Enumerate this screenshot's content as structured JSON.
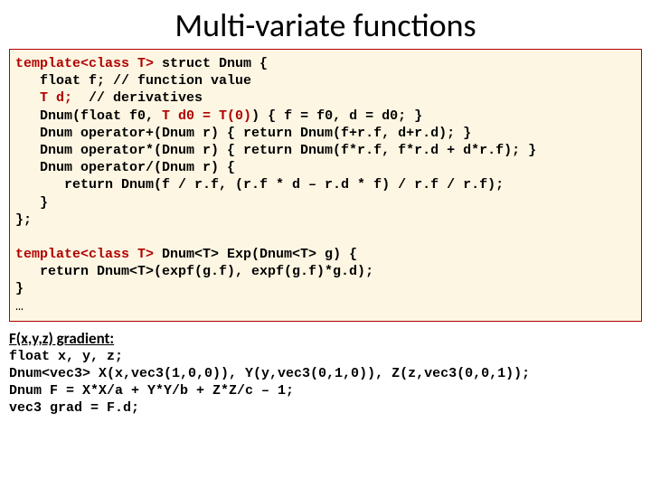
{
  "title": "Multi-variate functions",
  "code1": {
    "l1a": "template<class T>",
    "l1b": " struct Dnum {",
    "l2": "   float f; // function value",
    "l3a": "   ",
    "l3b": "T d;",
    "l3c": "  // derivatives",
    "l4a": "   Dnum(float f0, ",
    "l4b": "T d0 = T(0)",
    "l4c": ") { f = f0, d = d0; }",
    "l5": "   Dnum operator+(Dnum r) { return Dnum(f+r.f, d+r.d); }",
    "l6": "   Dnum operator*(Dnum r) { return Dnum(f*r.f, f*r.d + d*r.f); }",
    "l7": "   Dnum operator/(Dnum r) {",
    "l8": "      return Dnum(f / r.f, (r.f * d – r.d * f) / r.f / r.f);",
    "l9": "   }",
    "l10": "};",
    "blank": "",
    "l11a": "template<class T>",
    "l11b": " Dnum<T> Exp(Dnum<T> g) {",
    "l12": "   return Dnum<T>(expf(g.f), expf(g.f)*g.d);",
    "l13": "}",
    "l14": "…"
  },
  "subhead": "F(x,y,z) gradient:",
  "code2": {
    "l1": "float x, y, z;",
    "l2": "Dnum<vec3> X(x,vec3(1,0,0)), Y(y,vec3(0,1,0)), Z(z,vec3(0,0,1));",
    "l3": "Dnum F = X*X/a + Y*Y/b + Z*Z/c – 1;",
    "l4": "vec3 grad = F.d;"
  }
}
